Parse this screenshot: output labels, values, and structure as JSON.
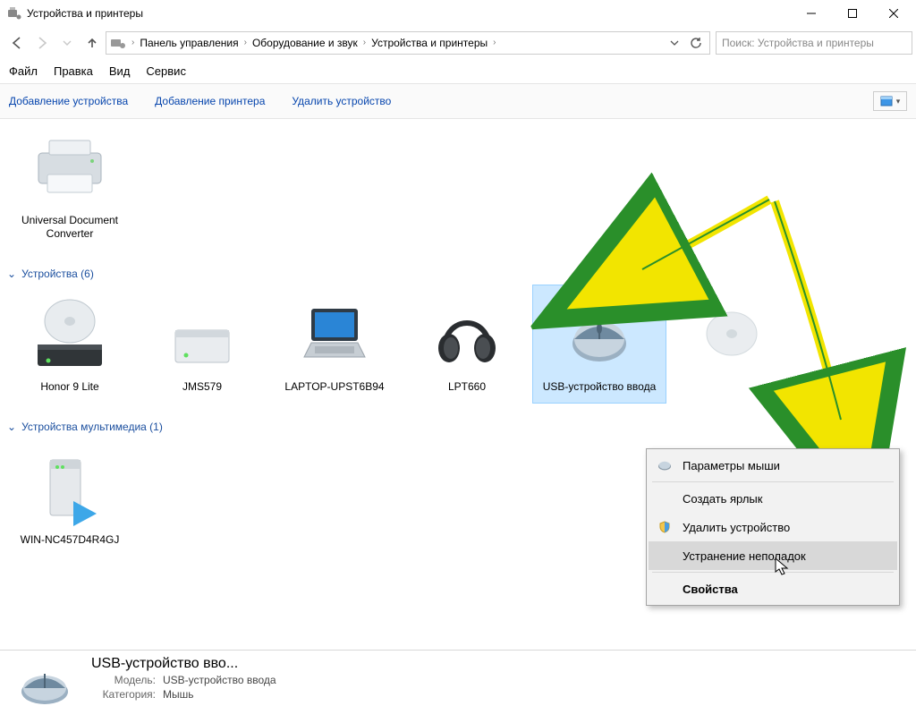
{
  "window": {
    "title": "Устройства и принтеры"
  },
  "breadcrumb": {
    "root": "Панель управления",
    "mid": "Оборудование и звук",
    "leaf": "Устройства и принтеры"
  },
  "search": {
    "placeholder": "Поиск: Устройства и принтеры"
  },
  "menubar": {
    "file": "Файл",
    "edit": "Правка",
    "view": "Вид",
    "service": "Сервис"
  },
  "cmdbar": {
    "add_device": "Добавление устройства",
    "add_printer": "Добавление принтера",
    "remove_device": "Удалить устройство"
  },
  "printers": {
    "items": [
      {
        "label": "Universal Document Converter"
      }
    ]
  },
  "devices": {
    "header": "Устройства (6)",
    "items": [
      {
        "label": "Honor 9 Lite"
      },
      {
        "label": "JMS579"
      },
      {
        "label": "LAPTOP-UPST6B94"
      },
      {
        "label": "LPT660"
      },
      {
        "label": "USB-устройство ввода"
      }
    ]
  },
  "multimedia": {
    "header": "Устройства мультимедиа (1)",
    "items": [
      {
        "label": "WIN-NC457D4R4GJ"
      }
    ]
  },
  "context_menu": {
    "mouse_params": "Параметры мыши",
    "create_shortcut": "Создать ярлык",
    "remove_device": "Удалить устройство",
    "troubleshoot": "Устранение неполадок",
    "properties": "Свойства"
  },
  "details": {
    "title": "USB-устройство вво...",
    "model_label": "Модель:",
    "model_value": "USB-устройство ввода",
    "category_label": "Категория:",
    "category_value": "Мышь"
  }
}
